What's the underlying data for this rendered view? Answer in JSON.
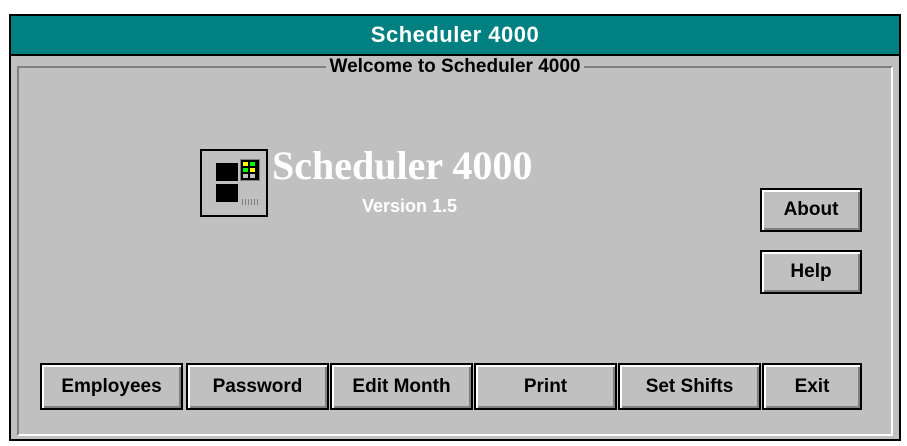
{
  "window": {
    "title": "Scheduler 4000"
  },
  "welcome": {
    "caption": "Welcome to Scheduler 4000",
    "logo_title": "Scheduler 4000",
    "version": "Version 1.5",
    "icon": "computer-icon"
  },
  "side_buttons": {
    "about": "About",
    "help": "Help"
  },
  "bottom_buttons": {
    "employees": "Employees",
    "password": "Password",
    "edit_month": "Edit Month",
    "print": "Print",
    "set_shifts": "Set Shifts",
    "exit": "Exit"
  },
  "colors": {
    "titlebar": "#008080",
    "window_face": "#c0c0c0",
    "logo_text": "#ffffff"
  }
}
